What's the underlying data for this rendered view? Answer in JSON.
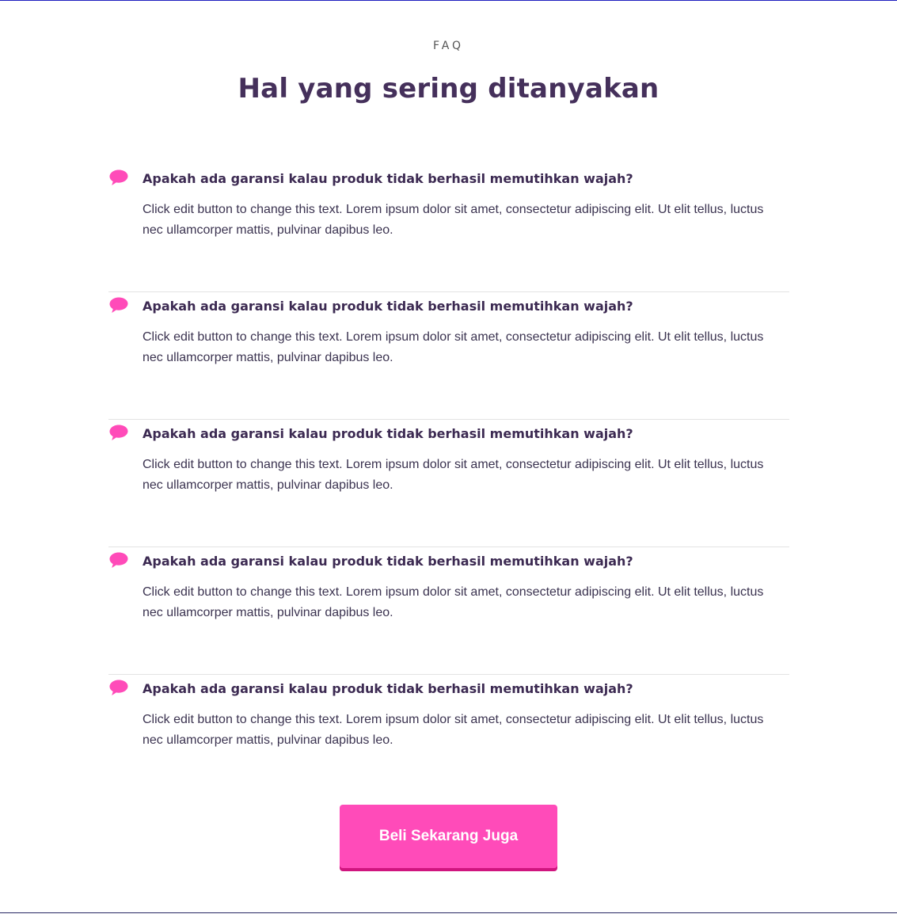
{
  "header": {
    "eyebrow": "FAQ",
    "title": "Hal yang sering ditanyakan"
  },
  "faq": {
    "icon": "speech-bubble-icon",
    "icon_color": "#ff4bb9",
    "items": [
      {
        "question": "Apakah ada garansi kalau produk tidak berhasil memutihkan wajah?",
        "answer": "Click edit button to change this text. Lorem ipsum dolor sit amet, consectetur adipiscing elit. Ut elit tellus, luctus nec ullamcorper mattis, pulvinar dapibus leo."
      },
      {
        "question": "Apakah ada garansi kalau produk tidak berhasil memutihkan wajah?",
        "answer": "Click edit button to change this text. Lorem ipsum dolor sit amet, consectetur adipiscing elit. Ut elit tellus, luctus nec ullamcorper mattis, pulvinar dapibus leo."
      },
      {
        "question": "Apakah ada garansi kalau produk tidak berhasil memutihkan wajah?",
        "answer": "Click edit button to change this text. Lorem ipsum dolor sit amet, consectetur adipiscing elit. Ut elit tellus, luctus nec ullamcorper mattis, pulvinar dapibus leo."
      },
      {
        "question": "Apakah ada garansi kalau produk tidak berhasil memutihkan wajah?",
        "answer": "Click edit button to change this text. Lorem ipsum dolor sit amet, consectetur adipiscing elit. Ut elit tellus, luctus nec ullamcorper mattis, pulvinar dapibus leo."
      },
      {
        "question": "Apakah ada garansi kalau produk tidak berhasil memutihkan wajah?",
        "answer": "Click edit button to change this text. Lorem ipsum dolor sit amet, consectetur adipiscing elit. Ut elit tellus, luctus nec ullamcorper mattis, pulvinar dapibus leo."
      }
    ]
  },
  "cta": {
    "label": "Beli Sekarang Juga",
    "color": "#ff4bb9"
  }
}
